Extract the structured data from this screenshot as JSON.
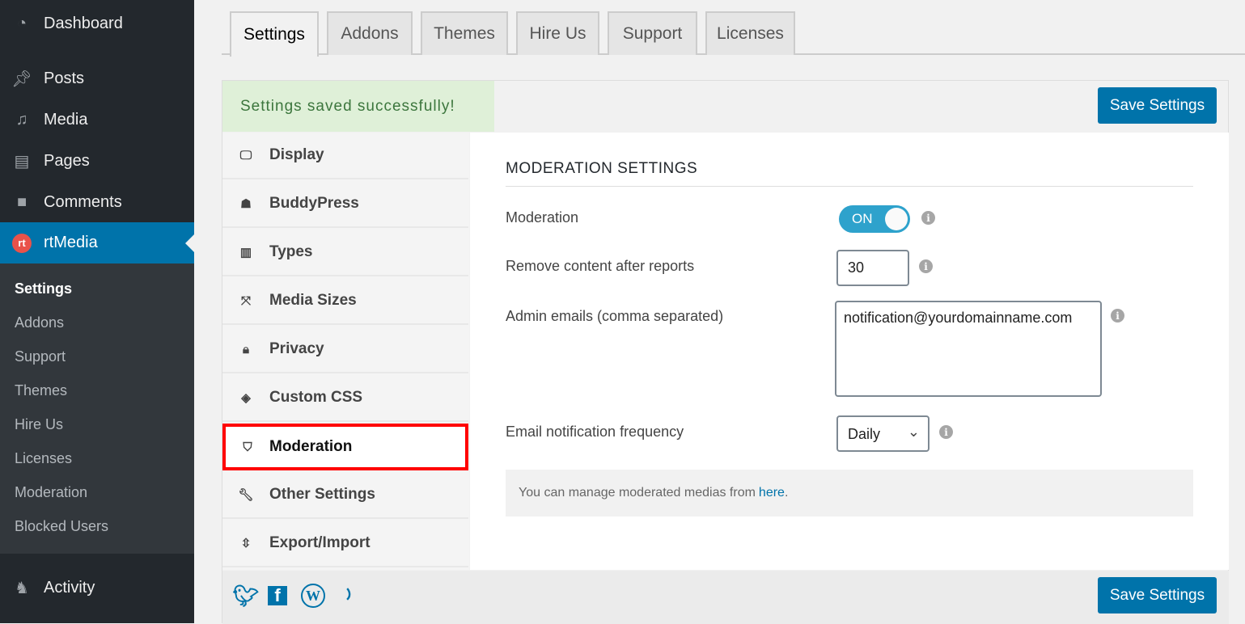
{
  "sidebar": {
    "items": [
      {
        "label": "Dashboard",
        "icon": "dashboard-icon"
      },
      {
        "label": "Posts",
        "icon": "pin-icon"
      },
      {
        "label": "Media",
        "icon": "media-icon"
      },
      {
        "label": "Pages",
        "icon": "pages-icon"
      },
      {
        "label": "Comments",
        "icon": "comment-icon"
      },
      {
        "label": "rtMedia",
        "icon": "rtmedia-icon"
      },
      {
        "label": "Activity",
        "icon": "activity-icon"
      }
    ],
    "submenu": [
      "Settings",
      "Addons",
      "Support",
      "Themes",
      "Hire Us",
      "Licenses",
      "Moderation",
      "Blocked Users"
    ]
  },
  "tabs": [
    "Settings",
    "Addons",
    "Themes",
    "Hire Us",
    "Support",
    "Licenses"
  ],
  "notice": "Settings saved successfully!",
  "save_label": "Save Settings",
  "nav": [
    "Display",
    "BuddyPress",
    "Types",
    "Media Sizes",
    "Privacy",
    "Custom CSS",
    "Moderation",
    "Other Settings",
    "Export/Import"
  ],
  "content": {
    "title": "MODERATION SETTINGS",
    "moderation_label": "Moderation",
    "moderation_toggle": "ON",
    "reports_label": "Remove content after reports",
    "reports_value": "30",
    "emails_label": "Admin emails (comma separated)",
    "emails_value": "notification@yourdomainname.com",
    "frequency_label": "Email notification frequency",
    "frequency_value": "Daily",
    "note": "You can manage moderated medias from",
    "note_link": "here",
    "note_end": "."
  },
  "accent": "#0073aa"
}
